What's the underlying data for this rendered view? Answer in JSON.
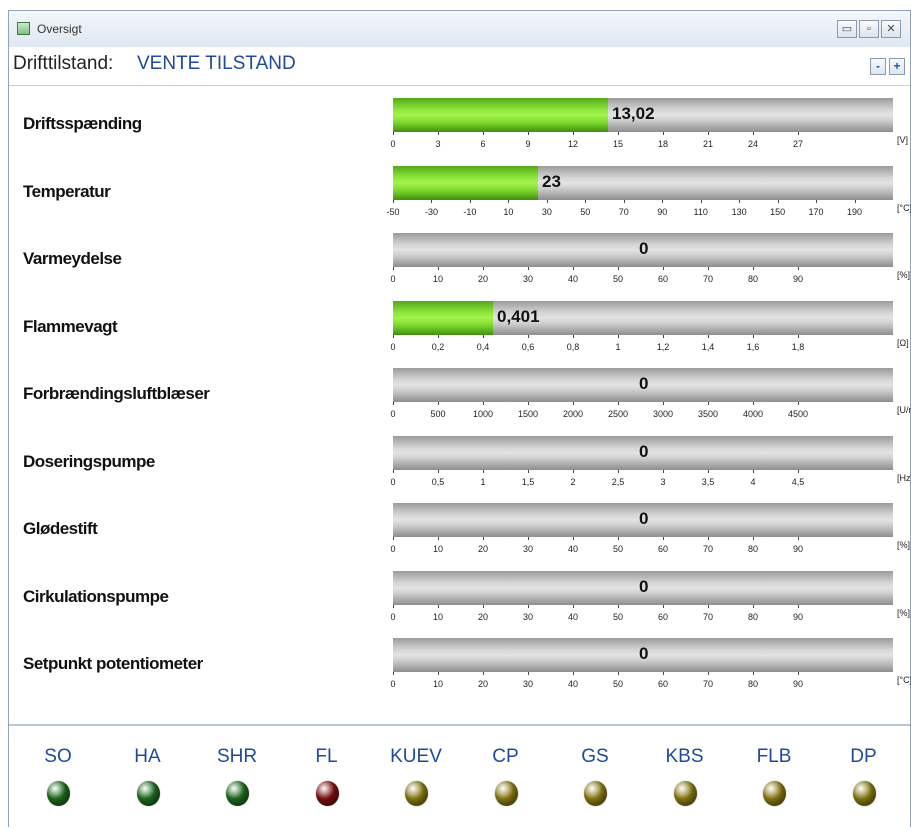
{
  "window": {
    "title": "Oversigt",
    "buttons": {
      "minimize": "▭",
      "maximize": "▫",
      "close": "✕"
    }
  },
  "mode": {
    "label": "Drifttilstand:",
    "value": "VENTE TILSTAND",
    "minus": "-",
    "plus": "+"
  },
  "gauges": [
    {
      "label": "Driftsspænding",
      "value": "13,02",
      "fill_fraction": 0.43,
      "unit": "[V]",
      "ticks": [
        "0",
        "3",
        "6",
        "9",
        "12",
        "15",
        "18",
        "21",
        "24",
        "27"
      ]
    },
    {
      "label": "Temperatur",
      "value": "23",
      "fill_fraction": 0.29,
      "unit": "[°C]",
      "ticks": [
        "-50",
        "-30",
        "-10",
        "10",
        "30",
        "50",
        "70",
        "90",
        "110",
        "130",
        "150",
        "170",
        "190"
      ]
    },
    {
      "label": "Varmeydelse",
      "value": "0",
      "fill_fraction": 0,
      "unit": "[%]",
      "ticks": [
        "0",
        "10",
        "20",
        "30",
        "40",
        "50",
        "60",
        "70",
        "80",
        "90"
      ]
    },
    {
      "label": "Flammevagt",
      "value": "0,401",
      "fill_fraction": 0.2,
      "unit": "[Ω]",
      "ticks": [
        "0",
        "0,2",
        "0,4",
        "0,6",
        "0,8",
        "1",
        "1,2",
        "1,4",
        "1,6",
        "1,8"
      ]
    },
    {
      "label": "Forbrændingsluftblæser",
      "value": "0",
      "fill_fraction": 0,
      "unit": "[U/min]",
      "ticks": [
        "0",
        "500",
        "1000",
        "1500",
        "2000",
        "2500",
        "3000",
        "3500",
        "4000",
        "4500"
      ]
    },
    {
      "label": "Doseringspumpe",
      "value": "0",
      "fill_fraction": 0,
      "unit": "[Hz]",
      "ticks": [
        "0",
        "0,5",
        "1",
        "1,5",
        "2",
        "2,5",
        "3",
        "3,5",
        "4",
        "4,5"
      ]
    },
    {
      "label": "Glødestift",
      "value": "0",
      "fill_fraction": 0,
      "unit": "[%]",
      "ticks": [
        "0",
        "10",
        "20",
        "30",
        "40",
        "50",
        "60",
        "70",
        "80",
        "90"
      ]
    },
    {
      "label": "Cirkulationspumpe",
      "value": "0",
      "fill_fraction": 0,
      "unit": "[%]",
      "ticks": [
        "0",
        "10",
        "20",
        "30",
        "40",
        "50",
        "60",
        "70",
        "80",
        "90"
      ]
    },
    {
      "label": "Setpunkt potentiometer",
      "value": "0",
      "fill_fraction": 0,
      "unit": "[°C]",
      "ticks": [
        "0",
        "10",
        "20",
        "30",
        "40",
        "50",
        "60",
        "70",
        "80",
        "90"
      ]
    }
  ],
  "lamps": [
    {
      "label": "SO",
      "color": "#1f6b1f"
    },
    {
      "label": "HA",
      "color": "#1f6b1f"
    },
    {
      "label": "SHR",
      "color": "#1f6b1f"
    },
    {
      "label": "FL",
      "color": "#7a1010"
    },
    {
      "label": "KUEV",
      "color": "#8a7a14"
    },
    {
      "label": "CP",
      "color": "#8a7a14"
    },
    {
      "label": "GS",
      "color": "#8a7a14"
    },
    {
      "label": "KBS",
      "color": "#8a7a14"
    },
    {
      "label": "FLB",
      "color": "#8a7a14"
    },
    {
      "label": "DP",
      "color": "#8a7a14"
    }
  ]
}
